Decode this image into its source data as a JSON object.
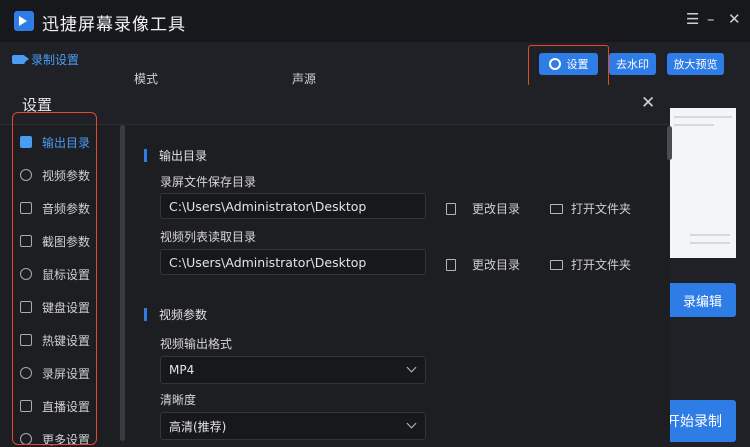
{
  "app": {
    "title": "迅捷屏幕录像工具"
  },
  "window_controls": {
    "menu": "☰",
    "minimize": "–",
    "close": "✕"
  },
  "toolbar": {
    "record_tab": "录制设置",
    "settings_label": "设置",
    "watermark_label": "去水印",
    "zoom_preview_label": "放大预览",
    "col_mode": "模式",
    "col_audio": "声源"
  },
  "background": {
    "edit_button_partial": "录编辑",
    "start_record_partial": "开始录制"
  },
  "dialog": {
    "title": "设置",
    "close": "✕",
    "nav": [
      {
        "label": "输出目录",
        "icon": "folder-icon",
        "active": true
      },
      {
        "label": "视频参数",
        "icon": "location-pin-icon",
        "active": false
      },
      {
        "label": "音频参数",
        "icon": "audio-grid-icon",
        "active": false
      },
      {
        "label": "截图参数",
        "icon": "crop-icon",
        "active": false
      },
      {
        "label": "鼠标设置",
        "icon": "mouse-icon",
        "active": false
      },
      {
        "label": "键盘设置",
        "icon": "keyboard-icon",
        "active": false
      },
      {
        "label": "热键设置",
        "icon": "hotkey-icon",
        "active": false
      },
      {
        "label": "录屏设置",
        "icon": "record-icon",
        "active": false
      },
      {
        "label": "直播设置",
        "icon": "live-camera-icon",
        "active": false
      },
      {
        "label": "更多设置",
        "icon": "more-icon",
        "active": false
      }
    ],
    "output_section": {
      "title": "输出目录",
      "save_dir_label": "录屏文件保存目录",
      "save_dir_value": "C:\\Users\\Administrator\\Desktop",
      "list_dir_label": "视频列表读取目录",
      "list_dir_value": "C:\\Users\\Administrator\\Desktop",
      "change_dir": "更改目录",
      "open_folder": "打开文件夹"
    },
    "video_section": {
      "title": "视频参数",
      "format_label": "视频输出格式",
      "format_value": "MP4",
      "clarity_label": "清晰度",
      "clarity_value": "高清(推荐)"
    }
  }
}
